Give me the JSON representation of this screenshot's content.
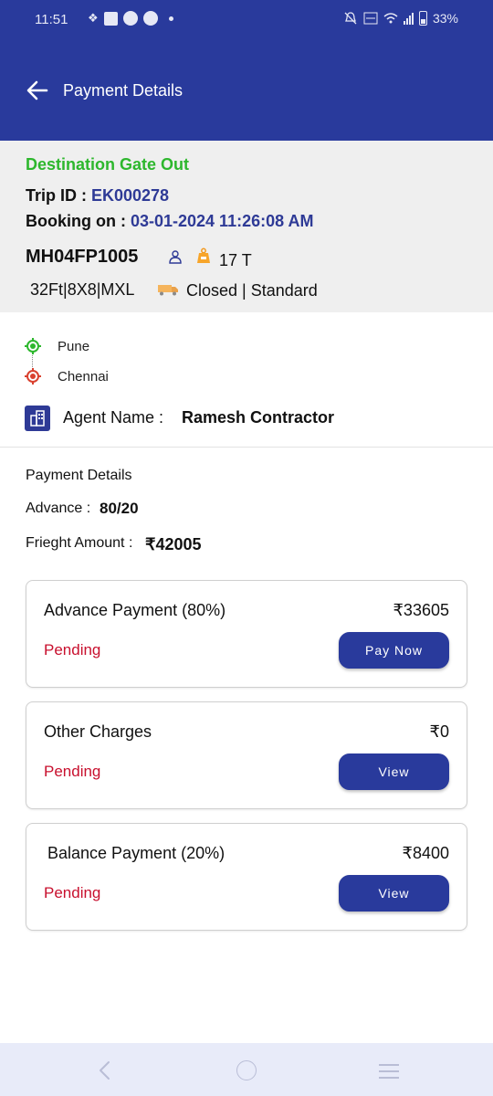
{
  "status_bar": {
    "time": "11:51",
    "battery": "33%",
    "icons": [
      "notification-icon",
      "message-icon",
      "app-icon",
      "app-icon",
      "dot-icon",
      "mute-icon",
      "volte-icon",
      "wifi-icon",
      "signal-icon",
      "battery-icon"
    ]
  },
  "header": {
    "title": "Payment Details",
    "back_icon": "arrow-left-icon"
  },
  "trip": {
    "status": "Destination Gate Out",
    "trip_id_label": "Trip ID : ",
    "trip_id": "EK000278",
    "booking_label": "Booking on : ",
    "booking_on": "03-01-2024 11:26:08 AM",
    "vehicle_number": "MH04FP1005",
    "weight": "17 T",
    "spec": "32Ft|8X8|MXL",
    "body_type": "Closed | Standard"
  },
  "route": {
    "origin": "Pune",
    "destination": "Chennai"
  },
  "agent": {
    "label": "Agent Name :",
    "name": "Ramesh Contractor"
  },
  "payment_summary": {
    "heading": "Payment Details",
    "advance_label": "Advance :",
    "advance_value": "80/20",
    "freight_label": "Frieght Amount :",
    "freight_value": "₹42005"
  },
  "cards": [
    {
      "title": "Advance Payment (80%)",
      "amount": "₹33605",
      "status": "Pending",
      "button": "Pay Now"
    },
    {
      "title": "Other Charges",
      "amount": "₹0",
      "status": "Pending",
      "button": "View"
    },
    {
      "title": "Balance Payment (20%)",
      "amount": "₹8400",
      "status": "Pending",
      "button": "View"
    }
  ],
  "colors": {
    "primary": "#293a9c",
    "status_green": "#2db72d",
    "pending_red": "#c8102e",
    "link_blue": "#2e3a96"
  }
}
